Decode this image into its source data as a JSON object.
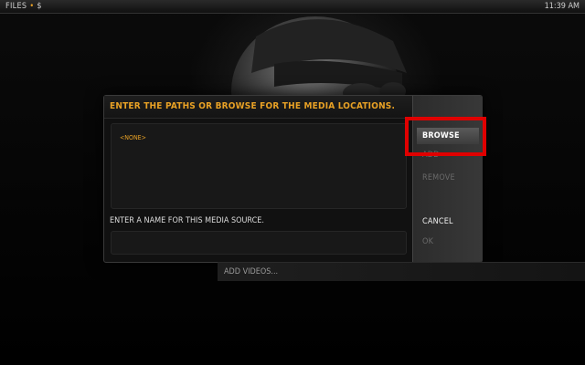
{
  "topbar": {
    "section": "FILES",
    "separator": "•",
    "path": "$",
    "clock": "11:39 AM"
  },
  "dialog": {
    "title": "ENTER THE PATHS OR BROWSE FOR THE MEDIA LOCATIONS.",
    "paths": [
      "<NONE>"
    ],
    "name_label": "ENTER A NAME FOR THIS MEDIA SOURCE.",
    "name_value": "",
    "buttons": {
      "browse": "BROWSE",
      "add": "ADD",
      "remove": "REMOVE",
      "cancel": "CANCEL",
      "ok": "OK"
    }
  },
  "background_menu": {
    "add_videos": "ADD VIDEOS..."
  },
  "colors": {
    "accent": "#e8a125",
    "highlight": "#e00000",
    "dialog_bg": "#111111"
  }
}
